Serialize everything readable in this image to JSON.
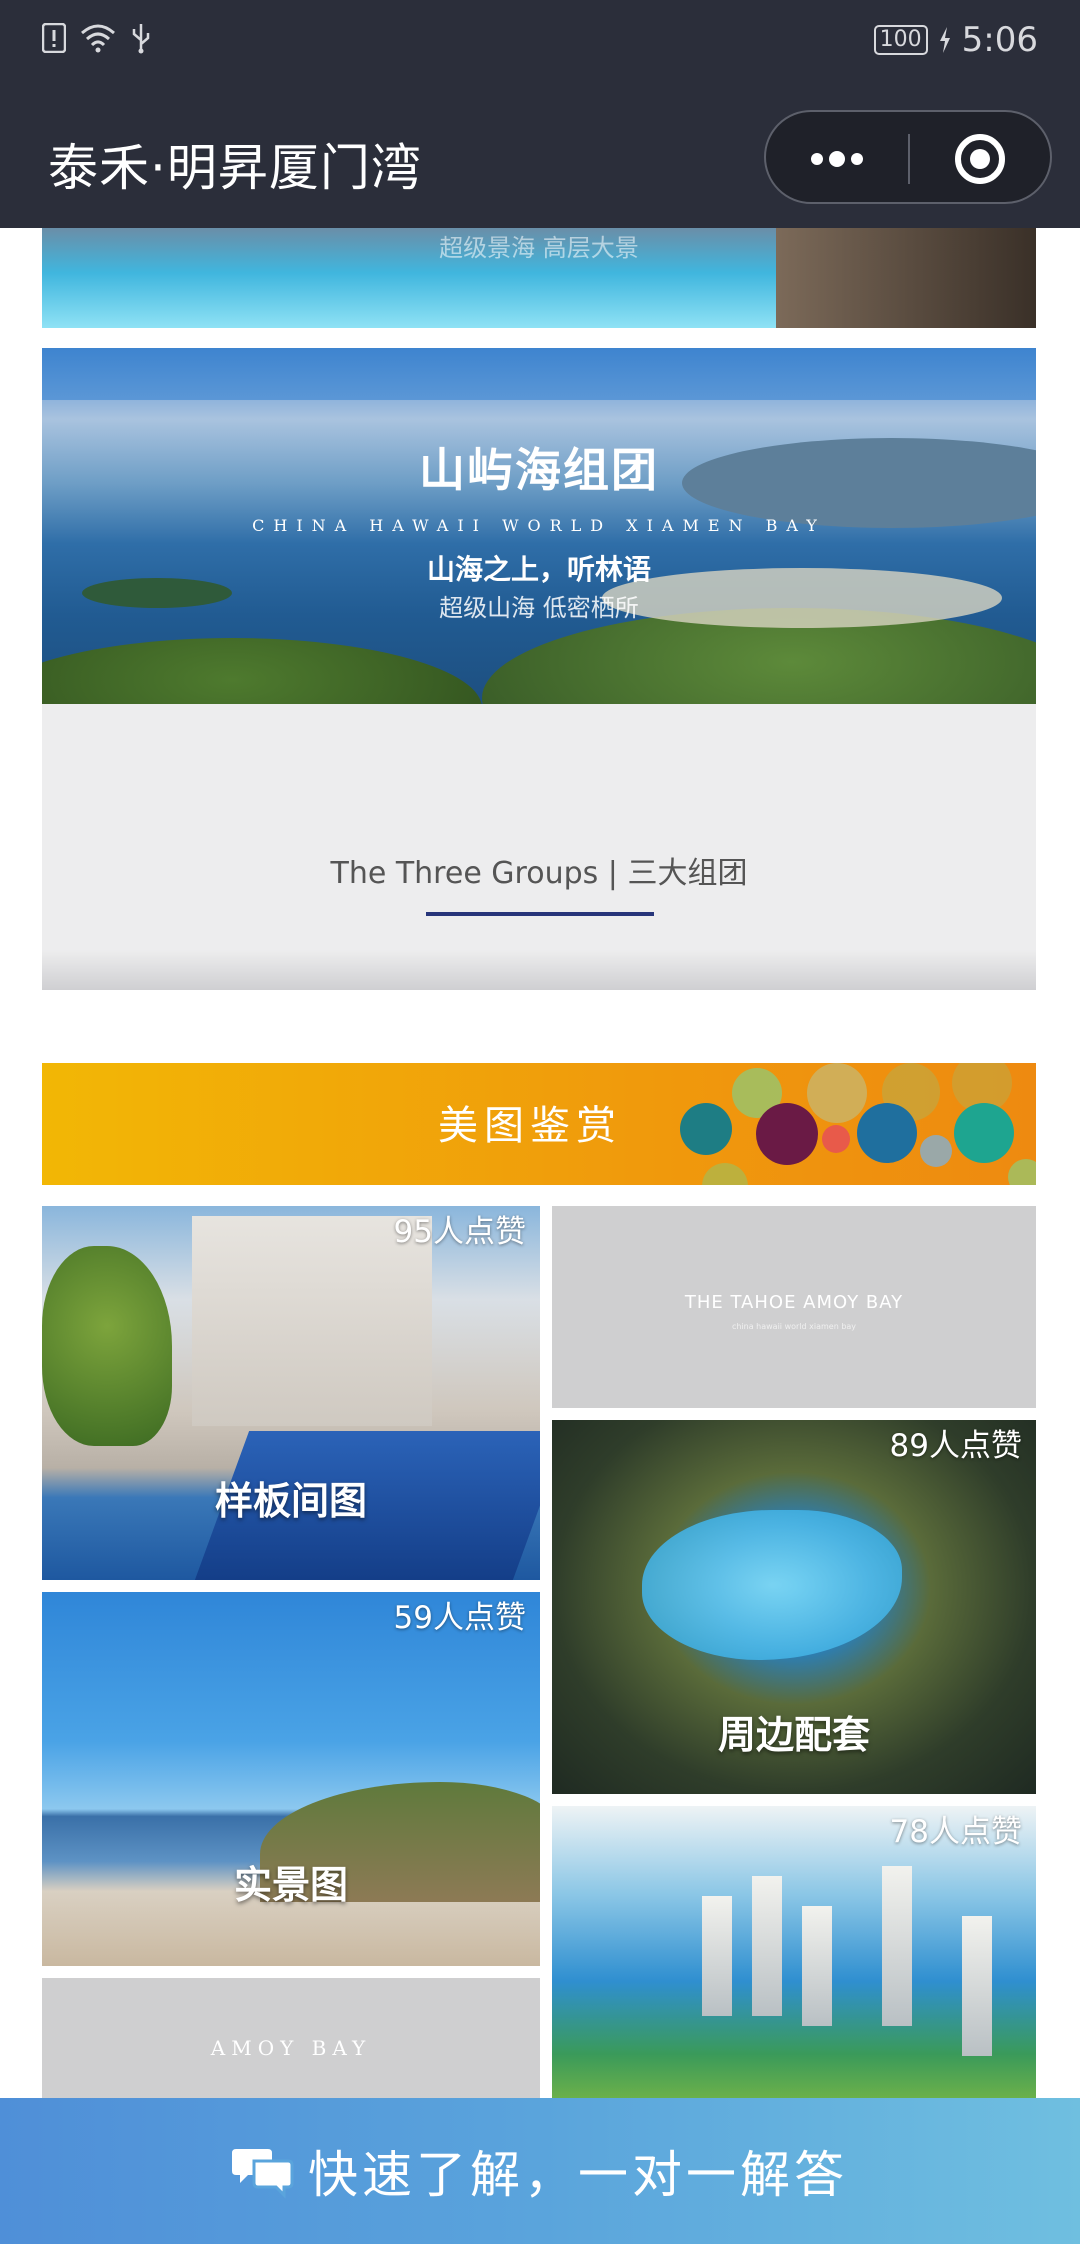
{
  "status_bar": {
    "battery": "100",
    "time": "5:06",
    "icons": [
      "notification-icon",
      "wifi-icon",
      "usb-icon",
      "charging-icon"
    ]
  },
  "header": {
    "title": "泰禾·明昇厦门湾",
    "more_icon": "more-dots-icon",
    "close_icon": "target-close-icon"
  },
  "top_banner": {
    "caption": "超级景海 高层大景"
  },
  "group_banner": {
    "title": "山屿海组团",
    "english": "CHINA HAWAII WORLD XIAMEN BAY",
    "subtitle": "山海之上，听林语",
    "subtitle2": "超级山海 低密栖所"
  },
  "groups_section": {
    "caption": "The Three Groups | 三大组团"
  },
  "gallery": {
    "banner_title": "美图鉴赏",
    "colors": {
      "banner_start": "#f2b705",
      "banner_end": "#ee8a10"
    },
    "tiles": [
      {
        "label": "样板间图",
        "likes": "95人点赞"
      },
      {
        "brand": "THE TAHOE AMOY BAY",
        "brand_sub": "china hawaii world xiamen bay"
      },
      {
        "label": "周边配套",
        "likes": "89人点赞"
      },
      {
        "label": "实景图",
        "likes": "59人点赞"
      },
      {
        "likes": "78人点赞"
      },
      {
        "brand": "AMOY BAY"
      }
    ]
  },
  "bottom_bar": {
    "text": "快速了解，一对一解答",
    "icon": "chat-bubbles-icon"
  }
}
